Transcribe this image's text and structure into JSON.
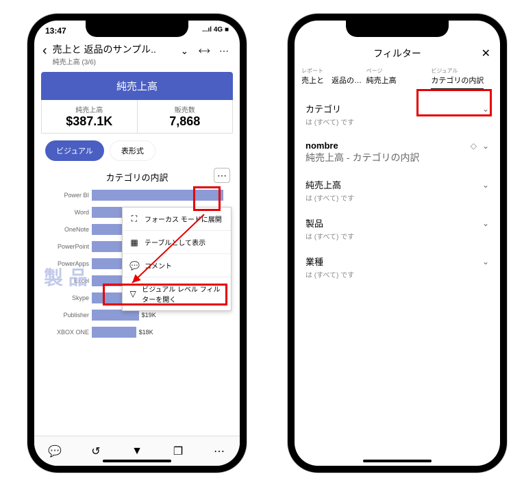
{
  "status": {
    "time": "13:47",
    "signal": "4G"
  },
  "header": {
    "title": "売上と  返品のサンプル..",
    "sub": "純売上高 (3/6)"
  },
  "kpi": {
    "banner": "純売上高",
    "left_label": "純売上高",
    "left_value": "$387.1K",
    "right_label": "販売数",
    "right_value": "7,868"
  },
  "seg": {
    "visual": "ビジュアル",
    "tabular": "表形式"
  },
  "chart": {
    "title": "カテゴリの内訳",
    "watermark": "製 品"
  },
  "chart_data": {
    "type": "bar",
    "title": "カテゴリの内訳",
    "xlabel": "",
    "ylabel": "",
    "categories": [
      "Power BI",
      "Word",
      "OneNote",
      "PowerPoint",
      "PowerApps",
      "Excel",
      "Skype",
      "Publisher",
      "XBOX ONE"
    ],
    "values": [
      55,
      38,
      34,
      30,
      23,
      21,
      20,
      19,
      18
    ],
    "value_labels": [
      "",
      "",
      "",
      "",
      "$23K",
      "$21K",
      "$20K",
      "$19K",
      "$18K"
    ],
    "bar_pct": [
      95,
      70,
      62,
      55,
      42,
      38,
      36,
      34,
      32
    ]
  },
  "menu": {
    "focus": "フォーカス モードに展開",
    "table": "テーブルとして表示",
    "comment": "コメント",
    "open_filter": "ビジュアル レベル フィルターを開く"
  },
  "p2": {
    "title": "フィルター",
    "tabs": {
      "report_t": "レポート",
      "report_v": "売上と　返品のサンプル..",
      "page_t": "ページ",
      "page_v": "純売上高",
      "visual_t": "ビジュアル",
      "visual_v": "カテゴリの内訳"
    },
    "filters": {
      "cat_title": "カテゴリ",
      "cat_sub": "は (すべて) です",
      "nombre_title": "nombre",
      "nombre_l": "純売上高 -",
      "nombre_r": "カテゴリの内訳",
      "net_title": "純売上高",
      "net_sub": "は (すべて) です",
      "prod_title": "製品",
      "prod_sub": "は (すべて) です",
      "ind_title": "業種",
      "ind_sub": "は (すべて) です"
    }
  }
}
